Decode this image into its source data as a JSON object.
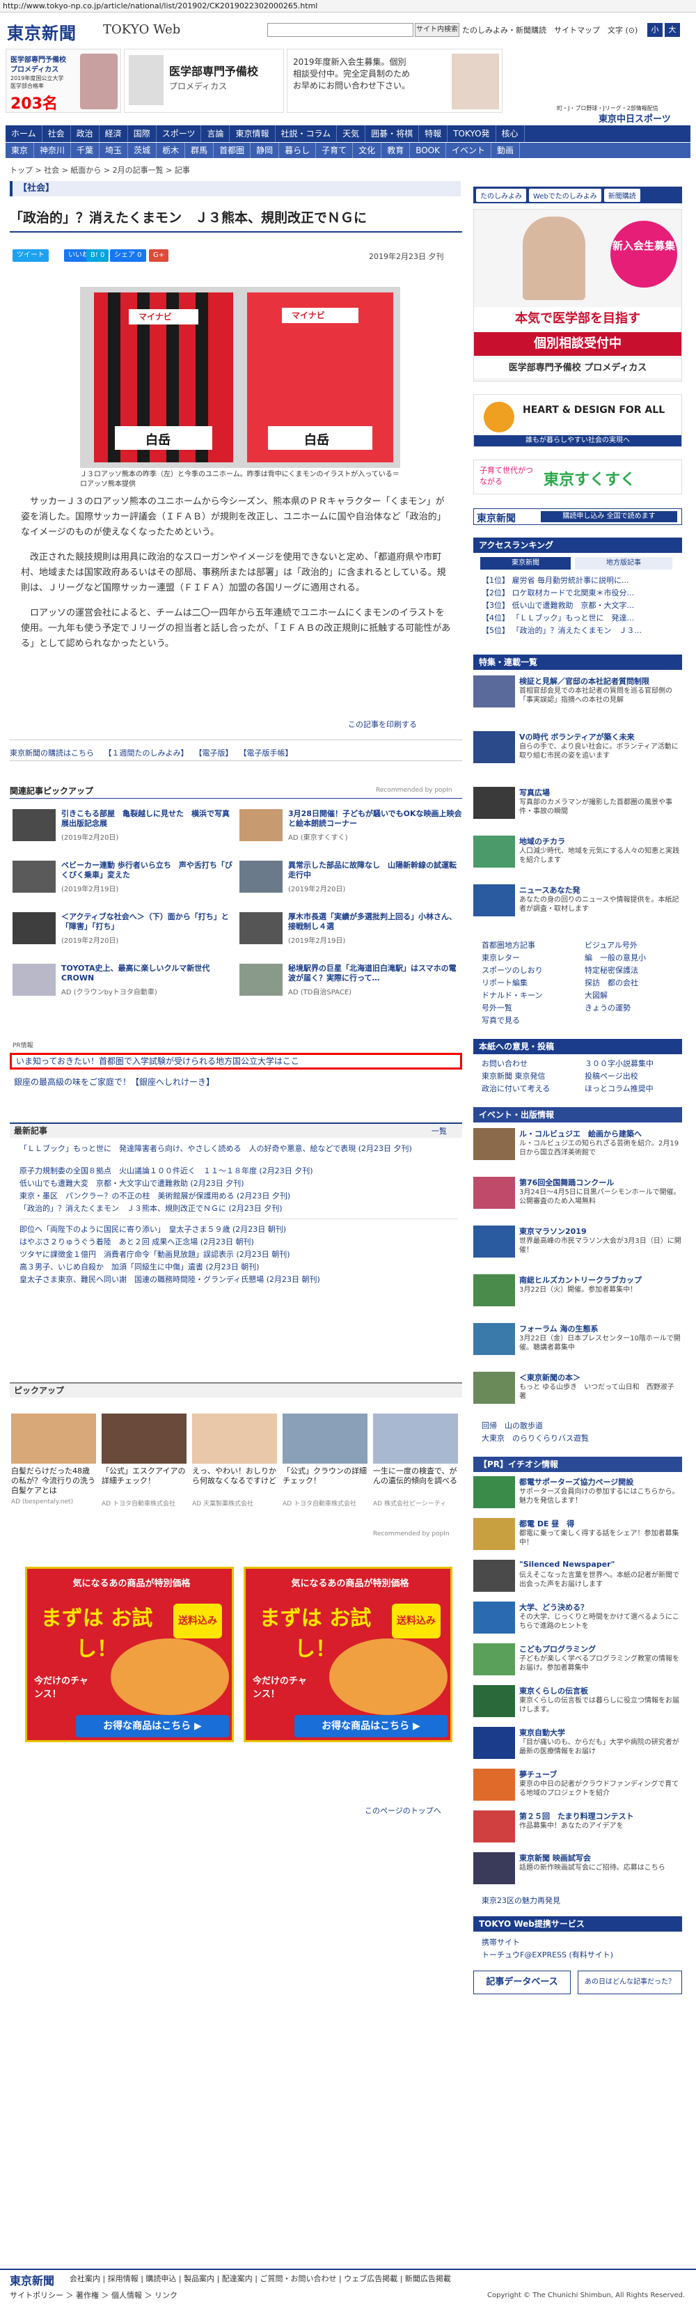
{
  "browser": {
    "url": "http://www.tokyo-np.co.jp/article/national/list/201902/CK2019022302000265.html"
  },
  "header": {
    "logo": "東京新聞",
    "logo_sub": "TOKYO Web",
    "search_button": "サイト内検索",
    "top_links": "たのしみよみ・新聞購読　サイトマップ　文字 (⊙)",
    "font_small": "小",
    "font_large": "大"
  },
  "ads_top": {
    "ad1_line1": "医学部専門予備校",
    "ad1_line2": "プロメディカス",
    "ad1_line3": "2019年度国公立大学医学部合格率",
    "ad1_big": "203名",
    "ad2_title": "医学部専門予備校",
    "ad2_sub": "プロメディカス",
    "ad3_line1": "2019年度新入会生募集。個別",
    "ad3_line2": "相談受付中。完全定員制のため",
    "ad3_line3": "お早めにお問い合わせ下さい。",
    "sports_tag": "町・J・プロ野球・Jリーグ・2部情報配信",
    "sports_logo": "東京中日スポーツ"
  },
  "nav": {
    "primary": [
      "ホーム",
      "社会",
      "政治",
      "経済",
      "国際",
      "スポーツ",
      "言論",
      "東京情報",
      "社説・コラム",
      "天気",
      "囲碁・将棋",
      "特報",
      "TOKYO発",
      "核心"
    ],
    "secondary": [
      "東京",
      "神奈川",
      "千葉",
      "埼玉",
      "茨城",
      "栃木",
      "群馬",
      "首都圏",
      "静岡",
      "暮らし",
      "子育て",
      "文化",
      "教育",
      "BOOK",
      "イベント",
      "動画"
    ]
  },
  "breadcrumb": "トップ > 社会 > 紙面から > 2月の記事一覧 > 記事",
  "section_label": "【社会】",
  "article": {
    "title": "「政治的」？消えたくまモン　Ｊ３熊本、規則改正でＮＧに",
    "share": [
      "ツイート",
      "いいね 0",
      "B! 0",
      "シェア 0",
      "G+"
    ],
    "date": "2019年2月23日 夕刊",
    "photo_shirt_text": "白岳",
    "photo_sponsor": "マイナビ",
    "caption": "Ｊ３ロアッソ熊本の昨季（左）と今季のユニホーム。昨季は背中にくまモンのイラストが入っている＝ロアッソ熊本提供",
    "paragraphs": [
      "サッカーＪ３のロアッソ熊本のユニホームから今シーズン、熊本県のＰＲキャラクター「くまモン」が姿を消した。国際サッカー評議会（ＩＦＡＢ）が規則を改正し、ユニホームに国や自治体など「政治的」なイメージのものが使えなくなったためという。",
      "改正された競技規則は用具に政治的なスローガンやイメージを使用できないと定め、「都道府県や市町村、地域または国家政府あるいはその部局、事務所または部署」は「政治的」に含まれるとしている。規則は、Ｊリーグなど国際サッカー連盟（ＦＩＦＡ）加盟の各国リーグに適用される。",
      "ロアッソの運営会社によると、チームは二〇一四年から五年連続でユニホームにくまモンのイラストを使用。一九年も使う予定でＪリーグの担当者と話し合ったが、「ＩＦＡＢの改正規則に抵触する可能性がある」として認められなかったという。"
    ],
    "print_link": "この記事を印刷する"
  },
  "mid_links": [
    "東京新聞の購読はこちら",
    "【１週間たのしみよみ】",
    "【電子版】",
    "【電子版手帳】"
  ],
  "related": {
    "header": "関連記事ピックアップ",
    "recommended_by": "Recommended by popIn",
    "items": [
      {
        "title": "引きこもる部屋　亀裂越しに見せた　横浜で写真展出版記念展",
        "date": "(2019年2月20日)"
      },
      {
        "title": "3月28日開催！子どもが騒いでもOKな映画上映会と絵本朗読コーナー",
        "date": "AD (東京すくすく)"
      },
      {
        "title": "ベビーカー連動 歩行者いら立ち　声や舌打ち「びくびく乗車」変えた",
        "date": "(2019年2月19日)"
      },
      {
        "title": "異常示した部品に故障なし　山陽新幹線の試運転走行中",
        "date": "(2019年2月20日)"
      },
      {
        "title": "＜アクティブな社会へ＞（下）面から「打ち」と「障害」「打ち」",
        "date": "(2019年2月20日)"
      },
      {
        "title": "厚木市長選「実績が多選批判上回る」小林さん、接戦制し４選",
        "date": "(2019年2月19日)"
      },
      {
        "title": "TOYOTA史上、最高に楽しいクルマ新世代CROWN",
        "date": "AD (クラウンbyトヨタ自動車)"
      },
      {
        "title": "秘境駅界の巨星「北海道旧白滝駅」はスマホの電波が届く？実際に行って…",
        "date": "AD (TD自治SPACE)"
      }
    ],
    "pr_label": "PR情報",
    "pr_line1": "いま知っておきたい！首都圏で入学試験が受けられる地方国公立大学はここ",
    "pr_line2": "銀座の最高級の味をご家庭で！【銀座へしれけーき】"
  },
  "latest": {
    "header": "最新記事",
    "more": "一覧",
    "items": [
      "「ＬＬブック」もっと世に　発達障害者ら向け、やさしく読める　人の好奇や悪意、絵などで表現 (2月23日 夕刊)",
      "原子力規制委の全国８拠点　火山議論１００件近く　１１～１８年度 (2月23日 夕刊)",
      "低い山でも遭難大変　京都・大文字山で遭難救助 (2月23日 夕刊)",
      "東京・墨区　パンクラー？の不正の柱　美術館展が保護用める (2月23日 夕刊)",
      "「政治的」？消えたくまモン　Ｊ３熊本、規則改正でＮＧに (2月23日 夕刊)",
      "即位へ「両陛下のように国民に寄り添い」　皇太子さま５９歳 (2月23日 朝刊)",
      "はやぶさ２りゅうぐう着陸　あと２回 成果へ正念場 (2月23日 朝刊)",
      "ツタヤに課徴金１億円　消費者庁命令「動画見放題」誤認表示 (2月23日 朝刊)",
      "高３男子、いじめ自殺か　加須「同級生に中傷」遺書 (2月23日 朝刊)",
      "皇太子さま東京、難民へ同い謝　国連の職務時間陸・グランディ氏懇場 (2月23日 朝刊)"
    ]
  },
  "pickup": {
    "header": "ピックアップ",
    "items": [
      {
        "title": "白髪だらけだった48歳の私が？今流行りの洗う白髪ケアとは",
        "ad": "AD (bespentaly.net)"
      },
      {
        "title": "「公式」エスクアイアの詳細チェック！",
        "ad": "AD トヨタ自動車株式会社"
      },
      {
        "title": "えっ、やわい！おしりから何故なくなるですけど",
        "ad": "AD 天葉製薬株式会社"
      },
      {
        "title": "「公式」クラウンの詳細チェック！",
        "ad": "AD トヨタ自動車株式会社"
      },
      {
        "title": "一生に一度の検査で、がんの遺伝的傾向を調べる",
        "ad": "AD 株式会社ピーシーティ"
      }
    ],
    "recommended_by": "Recommended by popIn"
  },
  "banners": {
    "line1": "気になるあの商品が特別価格",
    "line2": "まずは お試し！",
    "tag": "送料込み",
    "line3": "今だけのチャンス！",
    "button": "お得な商品はこちら ▶"
  },
  "back_to_top": "このページのトップへ",
  "right": {
    "tabs": [
      "たのしみよみ",
      "Webでたのしみよみ",
      "新聞購読"
    ],
    "ad1_big": "新入会生募集",
    "ad1_tag": "本気で医学部を目指す",
    "ad1_desc": "個別相談受付中",
    "ad1_name": "医学部専門予備校 プロメディカス",
    "heart_title": "HEART & DESIGN FOR ALL",
    "heart_sub": "誰もが暮らしやすい社会の実現へ",
    "sukusuku_top": "子育て世代がつながる",
    "sukusuku_name": "東京すくすく",
    "paper_sign": "東京新聞",
    "paper_btn": "購読申し込み 全国で読めます",
    "ranking_header": "アクセスランキング",
    "ranking_tabs": [
      "東京新聞",
      "地方版記事"
    ],
    "ranking": [
      "【1位】 雇労省 毎月勤労統計事に説明に...",
      "【2位】 ロケ取材カードで北関東＊市役分...",
      "【3位】 低い山で遭難救助　京都・大文字...",
      "【4位】 「ＬＬブック」もっと世に　発達...",
      "【5位】 「政治的」？消えたくまモン　Ｊ３..."
    ],
    "tokuho_header": "特集・連載一覧",
    "tokuho": [
      {
        "t": "検証と見解／官邸の本社記者質問制限",
        "d": "首相官邸会見での本社記者の質問を巡る官邸側の「事実誤認」指摘への本社の見解"
      },
      {
        "t": "Vの時代 ボランティアが築く未来",
        "d": "自らの手で、より良い社会に。ボランティア活動に取り組む市民の姿を追います"
      },
      {
        "t": "写真広場",
        "d": "写真部のカメラマンが撮影した首都圏の風景や事件・事故の瞬間"
      },
      {
        "t": "地域のチカラ",
        "d": "人口減少時代、地域を元気にする人々の知恵と実践を紹介します"
      },
      {
        "t": "ニュースあなた発",
        "d": "あなたの身の回りのニュースや情報提供を。本紙記者が調査・取材します"
      }
    ],
    "links": [
      "首都圏地方記事",
      "東京レター",
      "スポーツのしおり",
      "リポート編集",
      "ドナルド・キーン",
      "号外一覧",
      "写真で見る",
      "ビジュアル号外",
      "編　一般の意見小",
      "特定秘密保護法",
      "探訪　都の会社",
      "大図解",
      "きょうの運勢"
    ],
    "reader_header": "本紙への意見・投稿",
    "reader": [
      "お問い合わせ",
      "東京新聞 東京発信",
      "政治に付いて考える",
      "３００字小説募集中",
      "投稿ページ出校",
      "ほっとコラム推奨中"
    ],
    "event_header": "イベント・出版情報",
    "events": [
      {
        "t": "ル・コルビュジエ　絵画から建築へ",
        "d": "ル・コルビュジエの知られざる芸術を紹介。2月19日から国立西洋美術館で"
      },
      {
        "t": "第76回全国舞踊コンクール",
        "d": "3月24日～4月5日に目黒パーシモンホールで開催。公開審査のため入場無料"
      },
      {
        "t": "東京マラソン2019",
        "d": "世界最高峰の市民マラソン大会が3月3日（日）に開催！"
      },
      {
        "t": "南総ヒルズカントリークラブカップ",
        "d": "3月22日（火）開催。参加者募集中！"
      },
      {
        "t": "フォーラム 海の生態系",
        "d": "3月22日（金）日本プレスセンター10階ホールで開催。聴講者募集中"
      },
      {
        "t": "＜東京新聞の本＞",
        "d": "もっと ゆる山歩き　いつだって山日和　西野淑子 著"
      }
    ],
    "region_links": [
      "回帰　山の散歩道",
      "大東京　のらりくらりバス遊覧"
    ],
    "pr_header": "【PR】イチオシ情報",
    "pr": [
      {
        "t": "都電サポーターズ協力ページ開設",
        "d": "サポーターズ会員向けの参加するにはこちらから。魅力を発信します！"
      },
      {
        "t": "都電 DE 昼　得",
        "d": "都電に乗って楽しく得する話をシェア！参加者募集中！"
      },
      {
        "t": "\"Silenced Newspaper\"",
        "d": "伝えそこなった言葉を世界へ。本紙の記者が新聞で出会った声をお届けします"
      },
      {
        "t": "大学、どう決める？",
        "d": "その大学、じっくりと時間をかけて選べるようにこちらで進路のヒントを"
      },
      {
        "t": "こどもプログラミング",
        "d": "子どもが楽しく学べるプログラミング教室の情報をお届け。参加者募集中"
      },
      {
        "t": "東京くらしの伝言板",
        "d": "東京くらしの伝言板では暮らしに役立つ情報をお届けします。"
      },
      {
        "t": "東京自動大学",
        "d": "「目が痛いのも、からだも」大学や病院の研究者が最新の医療情報をお届け"
      },
      {
        "t": "夢チューブ",
        "d": "東京の中日の記者がクラウドファンディングで育てる地域のプロジェクトを紹介"
      },
      {
        "t": "第２５回　たまり料理コンテスト",
        "d": "作品募集中！あなたのアイデアを"
      },
      {
        "t": "東京新聞 映画試写会",
        "d": "話題の新作映画試写会にご招待。応募はこちら"
      }
    ],
    "region_link2": "東京23区の魅力再発見",
    "web_header": "TOKYO Web提携サービス",
    "web": [
      "携帯サイト",
      "トーチュウF@EXPRESS (有料サイト)"
    ],
    "bottom_btn1": "記事データベース",
    "bottom_btn2": "あの日はどんな記事だった？"
  },
  "footer": {
    "logo": "東京新聞",
    "links": "会社案内 | 採用情報 | 購読申込 | 製品案内 | 配達案内 | ご質問・お問い合わせ | ウェブ広告掲載 | 新聞広告掲載",
    "row2": "サイトポリシー ＞ 著作権 ＞ 個人情報 ＞ リンク",
    "copyright": "Copyright © The Chunichi Shimbun, All Rights Reserved."
  }
}
